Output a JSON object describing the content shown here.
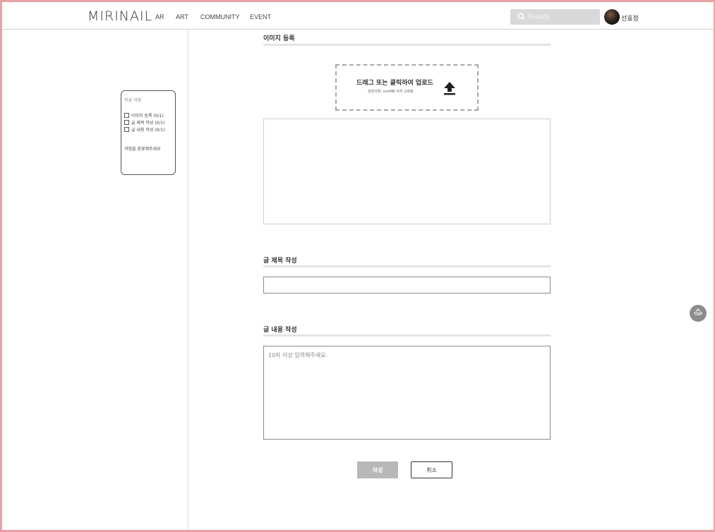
{
  "header": {
    "logo": "MIRINAIL",
    "nav": [
      "AR",
      "ART",
      "COMMUNITY",
      "EVENT"
    ],
    "search_placeholder": "Search",
    "user_name": "선효정"
  },
  "progress": {
    "title": "작성 과정",
    "items": [
      {
        "label": "이미지 등록 (0/1)",
        "checked": false
      },
      {
        "label": "글 제목 작성 (0/1)",
        "checked": false
      },
      {
        "label": "글 내용 작성 (0/1)",
        "checked": false
      }
    ],
    "note": "과정을 완료해주세요"
  },
  "image_section": {
    "title": "이미지 등록",
    "drop_text": "드래그 또는 클릭하여 업로드",
    "drop_sub": "권장사항: oooMB 이하 고화질"
  },
  "title_section": {
    "title": "글 제목 작성",
    "value": ""
  },
  "content_section": {
    "title": "글 내용 작성",
    "placeholder": "10자 이상 입력해주세요."
  },
  "buttons": {
    "submit": "작성",
    "cancel": "취소"
  },
  "top_button": "TOP",
  "colors": {
    "frame": "#e8a3a8",
    "search_bg": "#d9d9d9",
    "submit_bg": "#b8b8b8",
    "top_btn": "#8c8c8c"
  }
}
